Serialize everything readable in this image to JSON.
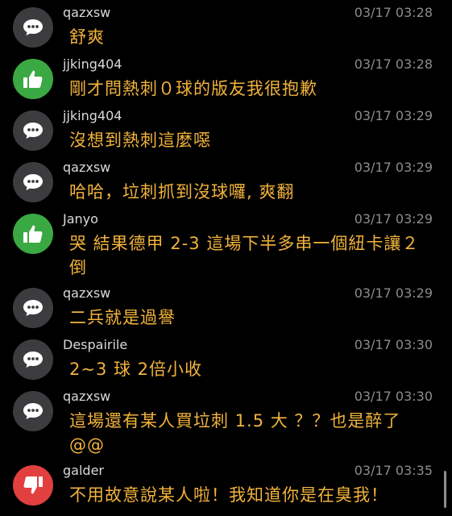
{
  "comments": [
    {
      "username": "qazxsw",
      "timestamp": "03/17 03:28",
      "message": "舒爽",
      "avatar_type": "comment-icon",
      "avatar_color": "#3c3c3e"
    },
    {
      "username": "jjking404",
      "timestamp": "03/17 03:28",
      "message": "剛才問熱刺０球的版友我很抱歉",
      "avatar_type": "thumbs-up-icon",
      "avatar_color": "#3aa843"
    },
    {
      "username": "jjking404",
      "timestamp": "03/17 03:29",
      "message": "沒想到熱刺這麼噁",
      "avatar_type": "comment-icon",
      "avatar_color": "#3c3c3e"
    },
    {
      "username": "qazxsw",
      "timestamp": "03/17 03:29",
      "message": "哈哈，垃刺抓到沒球囉, 爽翻",
      "avatar_type": "comment-icon",
      "avatar_color": "#3c3c3e"
    },
    {
      "username": "Janyo",
      "timestamp": "03/17 03:29",
      "message": "哭 結果德甲 2-3 這場下半多串一個紐卡讓２倒",
      "avatar_type": "thumbs-up-icon",
      "avatar_color": "#3aa843"
    },
    {
      "username": "qazxsw",
      "timestamp": "03/17 03:29",
      "message": "二兵就是過譽",
      "avatar_type": "comment-icon",
      "avatar_color": "#3c3c3e"
    },
    {
      "username": "Despairile",
      "timestamp": "03/17 03:30",
      "message": "2~3 球 2倍小收",
      "avatar_type": "comment-icon",
      "avatar_color": "#3c3c3e"
    },
    {
      "username": "qazxsw",
      "timestamp": "03/17 03:30",
      "message": "這場還有某人買垃刺 1.5 大 ？？也是醉了 @@",
      "avatar_type": "comment-icon",
      "avatar_color": "#3c3c3e"
    },
    {
      "username": "galder",
      "timestamp": "03/17 03:35",
      "message": "不用故意說某人啦！我知道你是在臭我！",
      "avatar_type": "thumbs-down-icon",
      "avatar_color": "#e2403e"
    }
  ]
}
